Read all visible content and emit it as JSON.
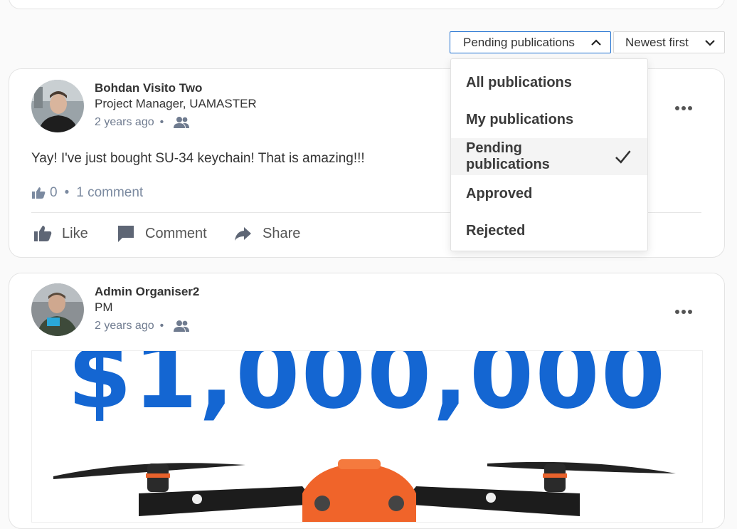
{
  "filters": {
    "status_label": "Pending publications",
    "sort_label": "Newest first"
  },
  "dropdown": {
    "items": [
      {
        "label": "All publications"
      },
      {
        "label": "My publications"
      },
      {
        "label": "Pending publications",
        "selected": true
      },
      {
        "label": "Approved"
      },
      {
        "label": "Rejected"
      }
    ]
  },
  "posts": [
    {
      "author": "Bohdan Visito Two",
      "role": "Project Manager, UAMASTER",
      "time": "2 years ago",
      "text": "Yay! I've just bought SU-34 keychain! That is amazing!!!",
      "likes": "0",
      "comments": "1 comment",
      "actions": {
        "like": "Like",
        "comment": "Comment",
        "share": "Share"
      }
    },
    {
      "author": "Admin Organiser2",
      "role": "PM",
      "time": "2 years ago",
      "image_text": "$1,000,000"
    }
  ],
  "colors": {
    "accent": "#1e6fd0",
    "meta": "#6f7b8f",
    "image_blue": "#1466d2"
  }
}
